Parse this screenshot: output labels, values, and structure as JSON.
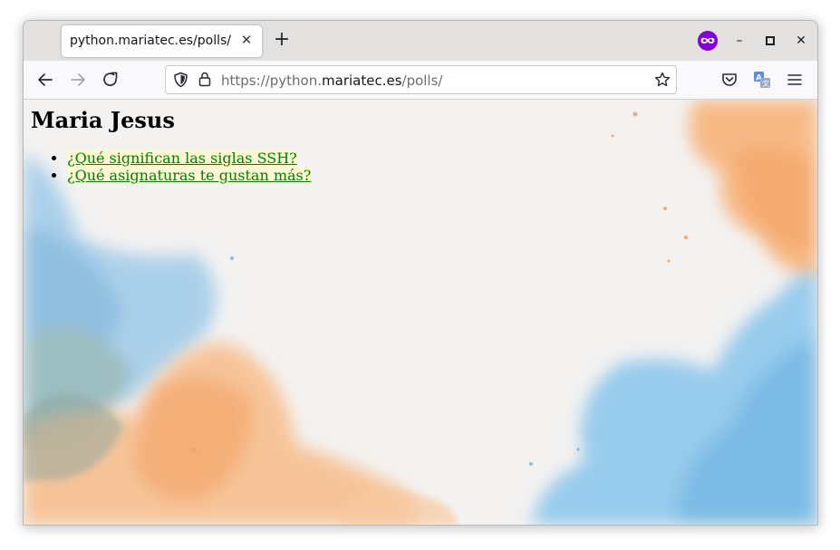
{
  "browser": {
    "tab_title": "python.mariatec.es/polls/",
    "tab_close_glyph": "✕",
    "new_tab_glyph": "+",
    "url_scheme": "https://python.",
    "url_host": "mariatec.es",
    "url_path": "/polls/",
    "window_min_glyph": "–",
    "window_max_glyph": "▢",
    "window_close_glyph": "✕",
    "icons": [
      "back-arrow-icon",
      "forward-arrow-icon",
      "reload-icon",
      "shield-icon",
      "lock-icon",
      "star-icon",
      "pocket-icon",
      "translate-icon",
      "menu-icon",
      "private-mask-icon"
    ]
  },
  "page": {
    "heading": "Maria Jesus",
    "questions": [
      "¿Qué significan las siglas SSH?",
      "¿Qué asignaturas te gustan más?"
    ]
  },
  "colors": {
    "link": "#008000",
    "watercolor_blue": "#8ec5e8",
    "watercolor_orange": "#f7b27a",
    "private_accent": "#8000d7"
  }
}
